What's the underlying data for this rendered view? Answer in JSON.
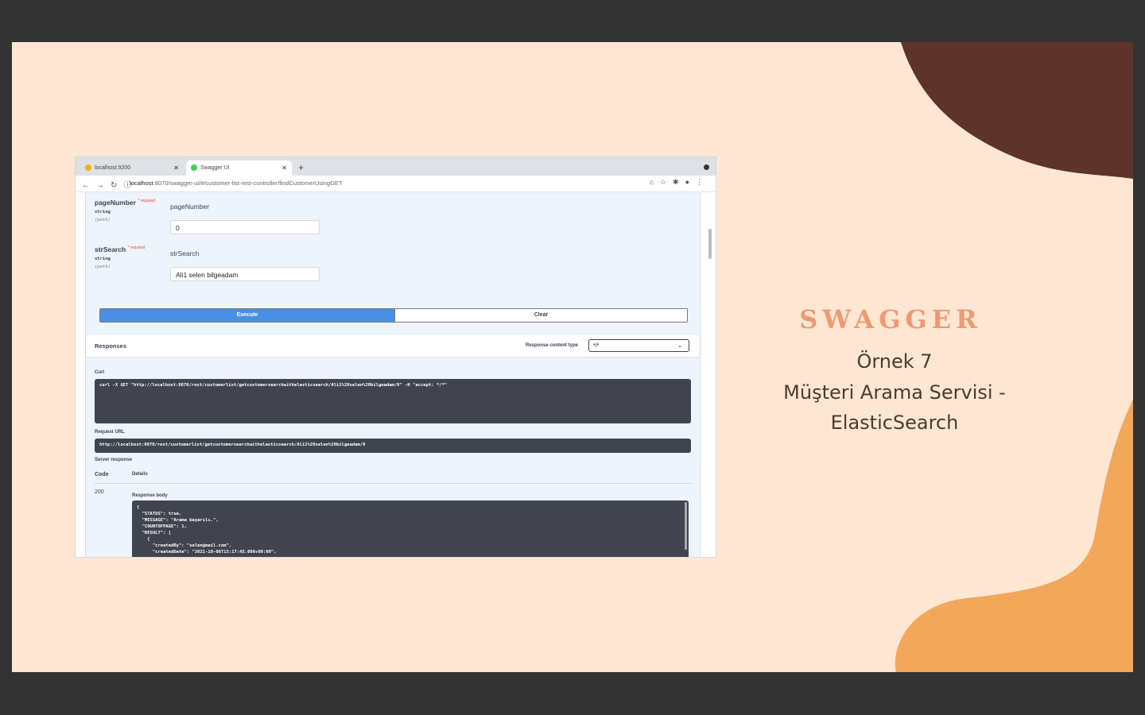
{
  "slide": {
    "title": "SWAGGER",
    "subtitle_line1": "Örnek 7",
    "subtitle_line2": "Müşteri Arama Servisi -",
    "subtitle_line3": "ElasticSearch",
    "colors": {
      "background": "#fde6d2",
      "accent": "#ec9a74",
      "brown": "#5e3329",
      "orange": "#f2a75a"
    }
  },
  "browser": {
    "tabs": [
      {
        "label": "localhost:9200",
        "icon": "elastic-favicon"
      },
      {
        "label": "Swagger UI",
        "icon": "swagger-favicon"
      }
    ],
    "url_host": "localhost",
    "url_rest": ":8070/swagger-ui/#/customer-list-rest-controller/findCustomerUsingGET"
  },
  "params": [
    {
      "name": "pageNumber",
      "required": "required",
      "type": "string",
      "location": "(path)",
      "description": "pageNumber",
      "value": "0"
    },
    {
      "name": "strSearch",
      "required": "required",
      "type": "string",
      "location": "(path)",
      "description": "strSearch",
      "value": "Ali1 selen bilgeadam"
    }
  ],
  "buttons": {
    "execute": "Execute",
    "clear": "Clear"
  },
  "responses": {
    "title": "Responses",
    "content_type_label": "Response content type",
    "content_type_value": "*/*",
    "curl_label": "Curl",
    "curl": "curl -X GET \"http://localhost:8070/rest/customerlist/getcustomersearchwithelasticsearch/Ali1%20selen%20bilgeadam/0\" -H \"accept: */*\"",
    "request_url_label": "Request URL",
    "request_url": "http://localhost:8070/rest/customerlist/getcustomersearchwithelasticsearch/Ali1%20selen%20bilgeadam/0",
    "server_response_label": "Server response",
    "col_code": "Code",
    "col_details": "Details",
    "status_code": "200",
    "response_body_label": "Response body",
    "response_body": "{\n  \"STATUS\": true,\n  \"MESSAGE\": \"Arama başarılı.\",\n  \"COUNTOFPAGE\": 1,\n  \"RESULT\": [\n    {\n      \"createdBy\": \"selen@mail.com\",\n      \"createdDate\": \"2021-10-06T15:17:45.000+00:00\","
  }
}
